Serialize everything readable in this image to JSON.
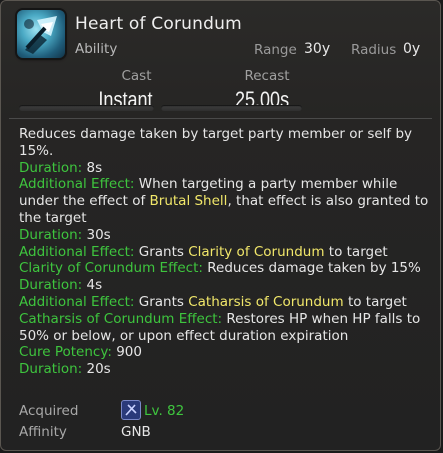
{
  "header": {
    "title": "Heart of Corundum",
    "type": "Ability",
    "range_label": "Range",
    "range_value": "30y",
    "radius_label": "Radius",
    "radius_value": "0y"
  },
  "timing": {
    "cast_label": "Cast",
    "cast_value": "Instant",
    "recast_label": "Recast",
    "recast_value": "25.00s"
  },
  "description": {
    "line1": "Reduces damage taken by target party member or self by 15%.",
    "duration_label": "Duration:",
    "duration_value": "8s",
    "add1_label": "Additional Effect:",
    "add1_text_a": "When targeting a party member while under the effect of",
    "add1_status": "Brutal Shell",
    "add1_text_b": ", that effect is also granted to the target",
    "duration2_label": "Duration:",
    "duration2_value": "30s",
    "add2_label": "Additional Effect:",
    "add2_text_a": "Grants",
    "add2_status": "Clarity of Corundum",
    "add2_text_b": "to target",
    "clarity_label": "Clarity of Corundum Effect:",
    "clarity_text": "Reduces damage taken by 15%",
    "duration3_label": "Duration:",
    "duration3_value": "4s",
    "add3_label": "Additional Effect:",
    "add3_text_a": "Grants",
    "add3_status": "Catharsis of Corundum",
    "add3_text_b": "to target",
    "catharsis_label": "Catharsis of Corundum Effect:",
    "catharsis_text": "Restores HP when HP falls to 50% or below, or upon effect duration expiration",
    "cure_label": "Cure Potency:",
    "cure_value": "900",
    "duration4_label": "Duration:",
    "duration4_value": "20s"
  },
  "footer": {
    "acquired_label": "Acquired",
    "acquired_value": "Lv. 82",
    "affinity_label": "Affinity",
    "affinity_value": "GNB"
  },
  "colors": {
    "green": "#3ec53e",
    "yellow": "#f1e76a",
    "text": "#e6e6e6"
  },
  "icons": {
    "ability": "heart-of-corundum-icon",
    "job": "gunbreaker-job-icon"
  }
}
